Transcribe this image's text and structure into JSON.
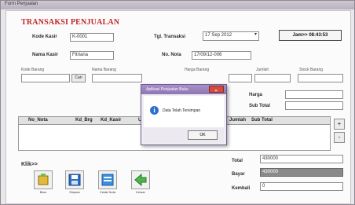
{
  "window": {
    "title": "Form Penjualan"
  },
  "header": {
    "title": "TRANSAKSI PENJUALAN",
    "clock": "Jam>> 08:43:53"
  },
  "form": {
    "kode_kasir_label": "Kode Kasir",
    "kode_kasir_value": "K-0001",
    "nama_kasir_label": "Nama Kasir",
    "nama_kasir_value": "Fitriana",
    "tgl_transaksi_label": "Tgl. Transaksi",
    "tgl_transaksi_value": "17 Sep 2012",
    "no_nota_label": "No. Nota",
    "no_nota_value": "17/09/12-006"
  },
  "item_row": {
    "kode_barang_label": "Kode Barang",
    "cari_button": "Cari",
    "nama_barang_label": "Nama Barang",
    "harga_barang_label": "Harga Barang",
    "jumlah_label": "Jumlah",
    "stock_label": "Stock Barang"
  },
  "summary_top": {
    "harga_label": "Harga",
    "subtotal_label": "Sub Total"
  },
  "table": {
    "columns": [
      "No_Nota",
      "Kd_Brg",
      "Kd_Kasir",
      "Ur",
      "Jumlah",
      "Sub Total"
    ]
  },
  "side_buttons": {
    "plus": "+",
    "minus": "-"
  },
  "toolbar": {
    "klik_label": "Klik>>",
    "items": [
      "Baru",
      "Simpan",
      "Cetak Nota",
      "Keluar"
    ]
  },
  "totals": {
    "total_label": "Total",
    "total_value": "430000",
    "bayar_label": "Bayar",
    "bayar_value": "430000",
    "kembali_label": "Kembali",
    "kembali_value": "0"
  },
  "dialog": {
    "title": "Aplikasi Penjualan Buku",
    "message": "Data Telah Tersimpan",
    "ok_label": "OK"
  },
  "colors": {
    "heading": "#c2252b",
    "dialog_title": "#8f76b4",
    "info_icon": "#2f6fd0"
  }
}
